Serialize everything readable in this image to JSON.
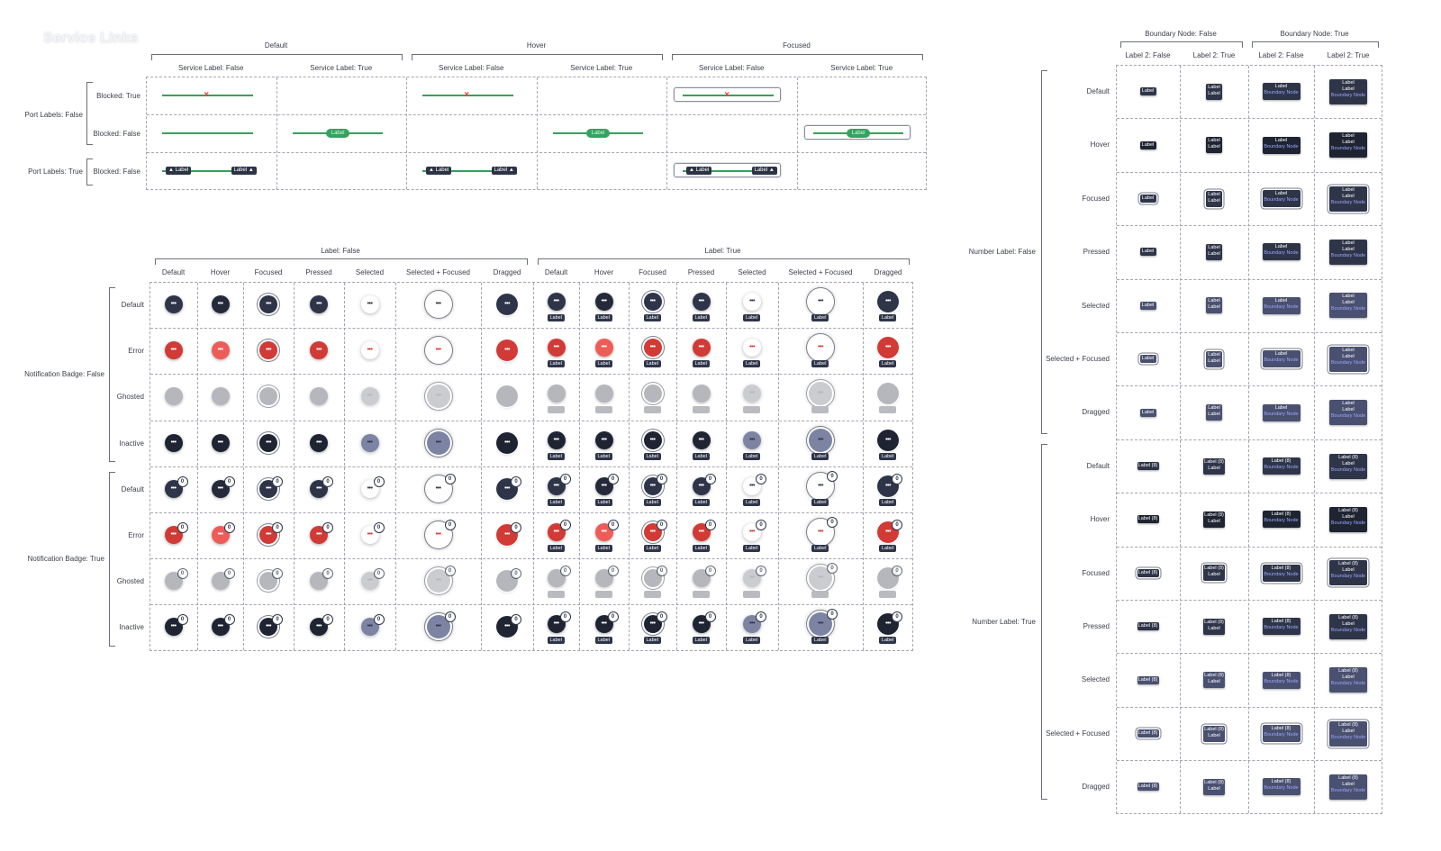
{
  "page_title": "Service Links",
  "colors": {
    "link_green": "#36a05c",
    "node_dark": "#2f3549",
    "node_error": "#d23a36",
    "node_hover_error": "#ef5c58",
    "node_ghost": "#9ea0a6",
    "node_selected_blue": "#7d84a3",
    "boundary_text_blue": "#9aa7ff"
  },
  "links": {
    "state_headers": [
      "Default",
      "Hover",
      "Focused"
    ],
    "service_label_headers": [
      "Service Label: False",
      "Service Label: True",
      "Service Label: False",
      "Service Label: True",
      "Service Label: False",
      "Service Label: True"
    ],
    "port_groups": [
      "Port Labels: False",
      "Port Labels: True"
    ],
    "blocked_rows": [
      "Blocked: True",
      "Blocked: False",
      "Blocked: False"
    ],
    "service_label_text": "Label",
    "port_label_text": "Label",
    "blocked_icon": "x-mark-icon"
  },
  "nodes": {
    "label_groups": [
      "Label: False",
      "Label: True"
    ],
    "state_columns": [
      "Default",
      "Hover",
      "Focused",
      "Pressed",
      "Selected",
      "Selected + Focused",
      "Dragged",
      "Default",
      "Hover",
      "Focused",
      "Pressed",
      "Selected",
      "Selected + Focused",
      "Dragged"
    ],
    "notification_groups": [
      "Notification Badge: False",
      "Notification Badge: True"
    ],
    "status_rows": [
      "Default",
      "Error",
      "Ghosted",
      "Inactive",
      "Default",
      "Error",
      "Ghosted",
      "Inactive"
    ],
    "node_label_text": "Label",
    "badge_count": "0",
    "node_icon": "more-dots-icon",
    "node_icon_glyph": "•••"
  },
  "boundary": {
    "boundary_groups": [
      "Boundary Node: False",
      "Boundary Node: True"
    ],
    "label2_columns": [
      "Label 2: False",
      "Label 2: True",
      "Label 2: False",
      "Label 2: True"
    ],
    "number_groups": [
      "Number Label: False",
      "Number Label: True"
    ],
    "state_rows": [
      "Default",
      "Hover",
      "Focused",
      "Pressed",
      "Selected",
      "Selected + Focused",
      "Dragged",
      "Default",
      "Hover",
      "Focused",
      "Pressed",
      "Selected",
      "Selected + Focused",
      "Dragged"
    ],
    "label_text": "Label",
    "numbered_label_text": "Label (8)",
    "boundary_node_text": "Boundary Node"
  }
}
